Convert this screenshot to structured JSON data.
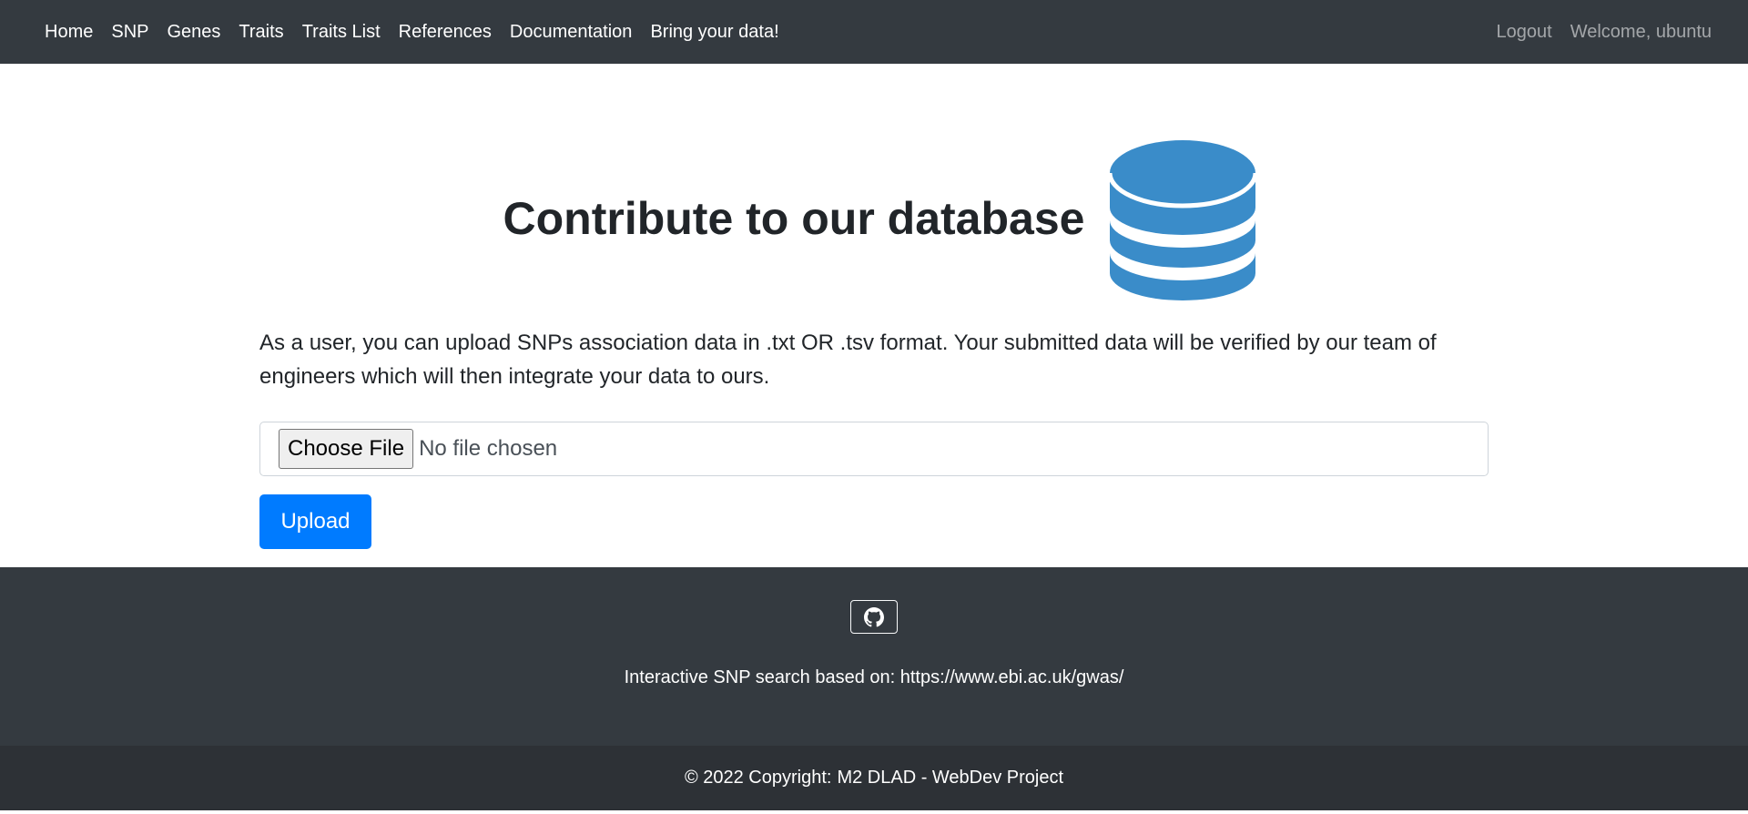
{
  "nav": {
    "items": [
      {
        "label": "Home"
      },
      {
        "label": "SNP"
      },
      {
        "label": "Genes"
      },
      {
        "label": "Traits"
      },
      {
        "label": "Traits List"
      },
      {
        "label": "References"
      },
      {
        "label": "Documentation"
      },
      {
        "label": "Bring your data!"
      }
    ],
    "logout": "Logout",
    "welcome": "Welcome, ubuntu"
  },
  "main": {
    "title": "Contribute to our database",
    "icon": "database-icon",
    "description": "As a user, you can upload SNPs association data in .txt OR .tsv format. Your submitted data will be verified by our team of engineers which will then integrate your data to ours.",
    "file_input": {
      "button_label": "Choose File",
      "status": "No file chosen"
    },
    "upload_label": "Upload"
  },
  "footer": {
    "github_icon": "github-icon",
    "text_prefix": "Interactive SNP search based on:",
    "link": "https://www.ebi.ac.uk/gwas/",
    "copyright_prefix": "© 2022 Copyright:",
    "copyright_link": "M2 DLAD - WebDev Project"
  },
  "colors": {
    "navbar_bg": "#343a40",
    "accent": "#007bff",
    "db_icon": "#3a8cc9",
    "copyright_bg": "#2d3136"
  }
}
